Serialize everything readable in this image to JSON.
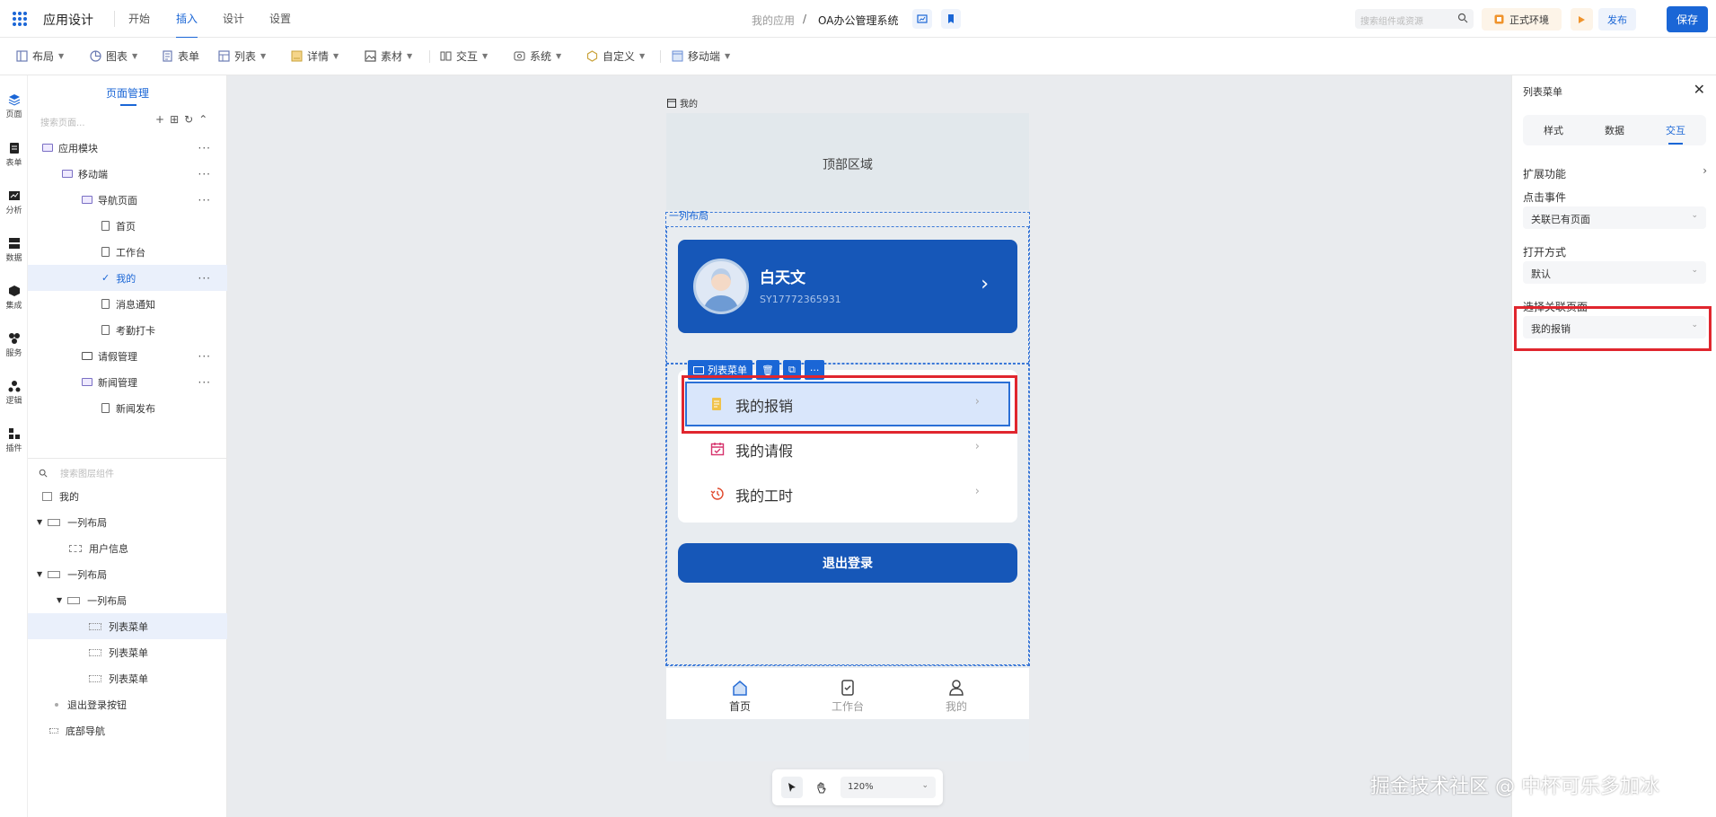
{
  "header": {
    "app_title": "应用设计",
    "tabs": [
      {
        "label": "开始"
      },
      {
        "label": "插入"
      },
      {
        "label": "设计"
      },
      {
        "label": "设置"
      }
    ],
    "breadcrumb": {
      "parent": "我的应用",
      "sep": "/",
      "current": "OA办公管理系统"
    },
    "search_placeholder": "搜索组件或资源",
    "env_label": "正式环境",
    "publish_label": "发布",
    "save_label": "保存",
    "accent_color": "#1a66d6"
  },
  "toolbar": {
    "items": [
      {
        "label": "布局",
        "icon": "layout-icon"
      },
      {
        "label": "图表",
        "icon": "chart-icon"
      },
      {
        "label": "表单",
        "icon": "form-icon"
      },
      {
        "label": "列表",
        "icon": "list-icon"
      },
      {
        "label": "详情",
        "icon": "detail-icon"
      },
      {
        "label": "素材",
        "icon": "image-icon"
      },
      {
        "label": "交互",
        "icon": "interact-icon"
      },
      {
        "label": "系统",
        "icon": "system-icon"
      },
      {
        "label": "自定义",
        "icon": "custom-icon"
      },
      {
        "label": "移动端",
        "icon": "mobile-icon"
      }
    ]
  },
  "rail": {
    "items": [
      {
        "label": "页面",
        "icon": "pages-icon"
      },
      {
        "label": "表单",
        "icon": "form-icon"
      },
      {
        "label": "分析",
        "icon": "analysis-icon"
      },
      {
        "label": "数据",
        "icon": "data-icon"
      },
      {
        "label": "集成",
        "icon": "integration-icon"
      },
      {
        "label": "服务",
        "icon": "service-icon"
      },
      {
        "label": "逻辑",
        "icon": "logic-icon"
      },
      {
        "label": "插件",
        "icon": "plugin-icon"
      }
    ]
  },
  "page_panel": {
    "title": "页面管理",
    "search_placeholder": "搜索页面...",
    "more": "···",
    "tree": [
      {
        "label": "应用模块",
        "type": "folder"
      },
      {
        "label": "移动端",
        "type": "folder"
      },
      {
        "label": "导航页面",
        "type": "folder"
      },
      {
        "label": "首页",
        "type": "page"
      },
      {
        "label": "工作台",
        "type": "page"
      },
      {
        "label": "我的",
        "type": "page",
        "selected": true
      },
      {
        "label": "消息通知",
        "type": "page"
      },
      {
        "label": "考勤打卡",
        "type": "page"
      },
      {
        "label": "请假管理",
        "type": "folder"
      },
      {
        "label": "新闻管理",
        "type": "folder"
      },
      {
        "label": "新闻发布",
        "type": "page"
      }
    ],
    "layer_search_placeholder": "搜索图层组件",
    "layers": [
      {
        "label": "我的"
      },
      {
        "label": "一列布局"
      },
      {
        "label": "用户信息"
      },
      {
        "label": "一列布局"
      },
      {
        "label": "一列布局"
      },
      {
        "label": "列表菜单",
        "selected": true
      },
      {
        "label": "列表菜单"
      },
      {
        "label": "列表菜单"
      },
      {
        "label": "退出登录按钮"
      },
      {
        "label": "底部导航"
      }
    ]
  },
  "canvas": {
    "page_label": "我的",
    "top_area": "顶部区域",
    "column_layout_label": "一列布局",
    "profile": {
      "name": "白天文",
      "id": "SY17772365931"
    },
    "selection_tag": "列表菜单",
    "menu": [
      {
        "label": "我的报销",
        "icon": "receipt-icon",
        "color": "#e8b23a"
      },
      {
        "label": "我的请假",
        "icon": "calendar-icon",
        "color": "#d6336c"
      },
      {
        "label": "我的工时",
        "icon": "clock-icon",
        "color": "#e0492c"
      }
    ],
    "logout_label": "退出登录",
    "tabbar": [
      {
        "label": "首页",
        "active": true
      },
      {
        "label": "工作台"
      },
      {
        "label": "我的"
      }
    ],
    "zoom": "120%"
  },
  "right_panel": {
    "title": "列表菜单",
    "tabs": [
      {
        "label": "样式"
      },
      {
        "label": "数据"
      },
      {
        "label": "交互",
        "active": true
      }
    ],
    "extend_label": "扩展功能",
    "click_event_label": "点击事件",
    "click_event_value": "关联已有页面",
    "open_mode_label": "打开方式",
    "open_mode_value": "默认",
    "link_page_label": "选择关联页面",
    "link_page_value": "我的报销"
  },
  "watermark": "掘金技术社区 @ 中杯可乐多加冰"
}
